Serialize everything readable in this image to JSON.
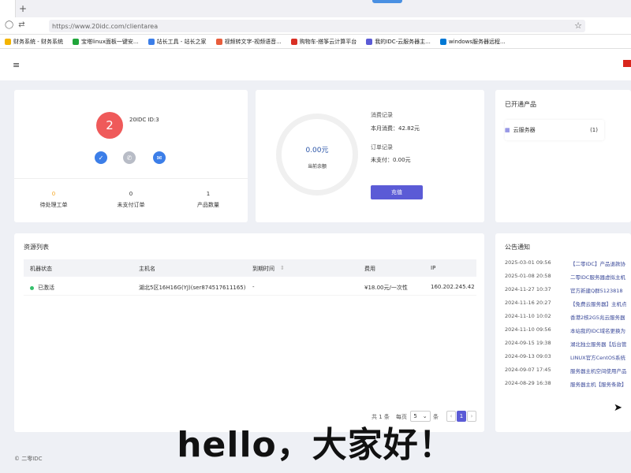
{
  "browser": {
    "new_tab": "+",
    "url": "https://www.20idc.com/clientarea",
    "bookmarks": [
      {
        "label": "财务系统 - 财务系统",
        "color": "#f4b400"
      },
      {
        "label": "宝塔linux面板一键安...",
        "color": "#20a53a"
      },
      {
        "label": "站长工具 - 站长之家",
        "color": "#3c7ee8"
      },
      {
        "label": "视频转文字-视频语音...",
        "color": "#e85d3c"
      },
      {
        "label": "购物车-搭筝云计算平台",
        "color": "#d93025"
      },
      {
        "label": "我的IDC-云服务器主...",
        "color": "#5b5bd6"
      },
      {
        "label": "windows服务器远程...",
        "color": "#0078d4"
      }
    ]
  },
  "header": {
    "menu_icon": "≡"
  },
  "profile": {
    "avatar_text": "2",
    "user_id": "20IDC ID:3",
    "stats": [
      {
        "num": "0",
        "label": "待处理工单"
      },
      {
        "num": "0",
        "label": "未支付订单"
      },
      {
        "num": "1",
        "label": "产品数量"
      }
    ]
  },
  "balance": {
    "amount": "0.00元",
    "amount_label": "当前余额",
    "consume_title": "消费记录",
    "consume_value": "本月消费：42.82元",
    "order_title": "订单记录",
    "order_value": "未支付：0.00元",
    "recharge_label": "充值"
  },
  "products": {
    "title": "已开通产品",
    "item_label": "云服务器",
    "item_count": "(1)"
  },
  "resources": {
    "title": "资源列表",
    "columns": [
      "机器状态",
      "主机名",
      "到期时间",
      "费用",
      "IP"
    ],
    "rows": [
      {
        "status": "已激活",
        "host": "湖北5区16H16G(YJ)(ser874517611165)",
        "expire": "-",
        "fee": "¥18.00元/一次性",
        "ip": "160.202.245.42"
      }
    ],
    "pager": {
      "total": "共 1 条",
      "per_page": "每页",
      "size": "5",
      "unit": "条",
      "prev": "‹",
      "page": "1",
      "next": "›"
    }
  },
  "notice": {
    "title": "公告通知",
    "items": [
      {
        "date": "2025-03-01 09:56",
        "text": "【二零IDC】产品退款协"
      },
      {
        "date": "2025-01-08 20:58",
        "text": "二零IDC服务器虚拟主机"
      },
      {
        "date": "2024-11-27 10:37",
        "text": "官方新建Q群5123818"
      },
      {
        "date": "2024-11-16 20:27",
        "text": "【免费云服务器】主机点"
      },
      {
        "date": "2024-11-10 10:02",
        "text": "香港2核2G5兆云服务器"
      },
      {
        "date": "2024-11-10 09:56",
        "text": "本站我的IDC域名更换为"
      },
      {
        "date": "2024-09-15 19:38",
        "text": "湖北独立服务器【后台管"
      },
      {
        "date": "2024-09-13 09:03",
        "text": "LINUX官方CentOS系统"
      },
      {
        "date": "2024-09-07 17:45",
        "text": "服务器主机空间使用产品"
      },
      {
        "date": "2024-08-29 16:38",
        "text": "服务器主机【服务条款】"
      }
    ]
  },
  "footer": {
    "copyright": "© 二零IDC"
  },
  "caption": "hello，大家好！"
}
